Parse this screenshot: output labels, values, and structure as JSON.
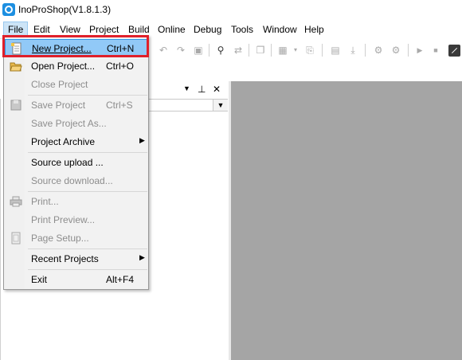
{
  "window": {
    "title": "InoProShop(V1.8.1.3)",
    "app_icon": "inoproshop-logo-icon"
  },
  "menubar": {
    "file": "File",
    "edit": "Edit",
    "view": "View",
    "project": "Project",
    "build": "Build",
    "online": "Online",
    "debug": "Debug",
    "tools": "Tools",
    "window": "Window",
    "help": "Help"
  },
  "file_menu": {
    "new_project": {
      "label": "New Project...",
      "shortcut": "Ctrl+N",
      "icon": "new-document-icon"
    },
    "open_project": {
      "label": "Open Project...",
      "shortcut": "Ctrl+O",
      "icon": "open-folder-icon"
    },
    "close_project": {
      "label": "Close Project"
    },
    "save_project": {
      "label": "Save Project",
      "shortcut": "Ctrl+S",
      "icon": "save-disk-icon"
    },
    "save_project_as": {
      "label": "Save Project As..."
    },
    "project_archive": {
      "label": "Project Archive"
    },
    "source_upload": {
      "label": "Source upload ..."
    },
    "source_download": {
      "label": "Source download..."
    },
    "print": {
      "label": "Print...",
      "icon": "printer-icon"
    },
    "print_preview": {
      "label": "Print Preview..."
    },
    "page_setup": {
      "label": "Page Setup...",
      "icon": "page-setup-icon"
    },
    "recent_projects": {
      "label": "Recent Projects"
    },
    "exit": {
      "label": "Exit",
      "shortcut": "Alt+F4"
    }
  },
  "panel": {
    "pin": "⭾",
    "close": "✕",
    "dropdown": "▼"
  },
  "colors": {
    "highlight": "#91c9f7",
    "annotation_box": "#e0202a",
    "workspace": "#a5a5a5"
  }
}
